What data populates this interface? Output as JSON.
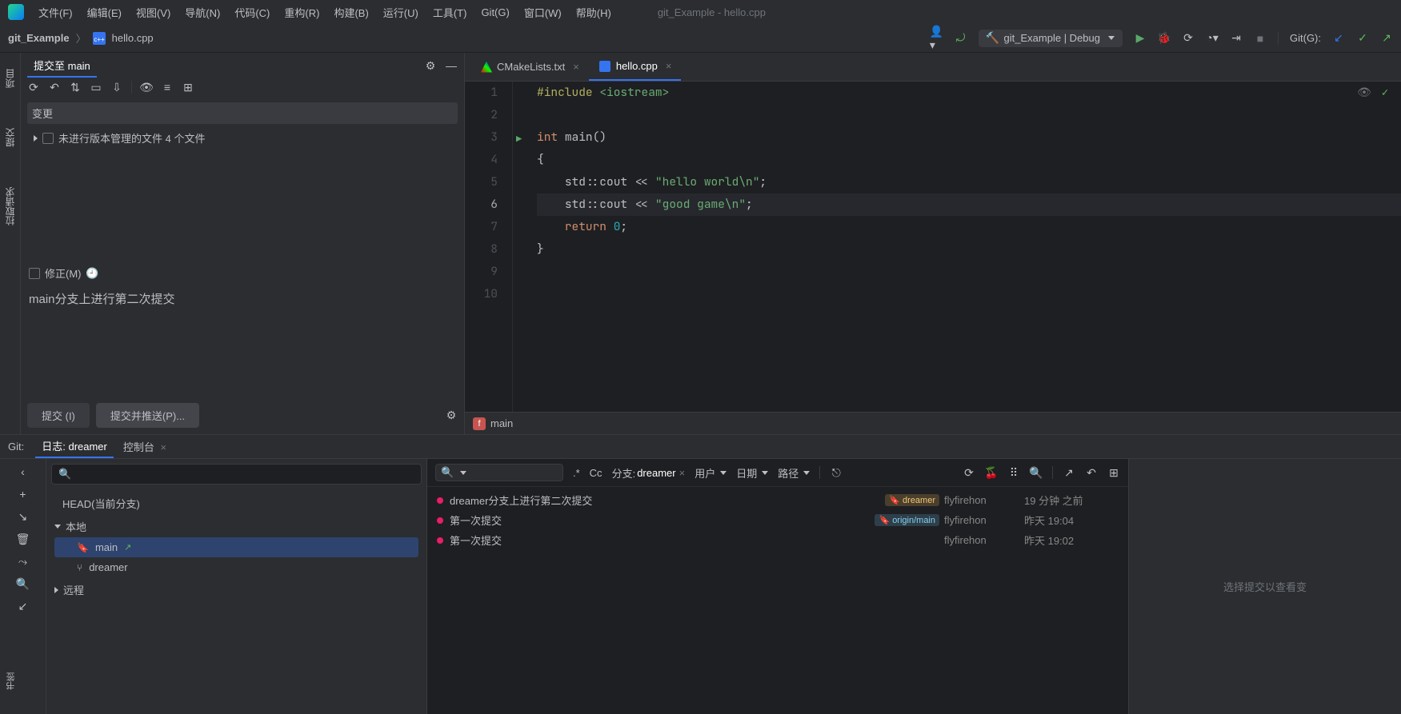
{
  "window_title": "git_Example - hello.cpp",
  "menus": [
    "文件(F)",
    "编辑(E)",
    "视图(V)",
    "导航(N)",
    "代码(C)",
    "重构(R)",
    "构建(B)",
    "运行(U)",
    "工具(T)",
    "Git(G)",
    "窗口(W)",
    "帮助(H)"
  ],
  "breadcrumbs": {
    "project": "git_Example",
    "file": "hello.cpp"
  },
  "run_config": "git_Example | Debug",
  "git_label": "Git(G):",
  "commit_panel": {
    "tab": "提交至 main",
    "changes_label": "变更",
    "unversioned": "未进行版本管理的文件 4 个文件",
    "amend_label": "修正(M)",
    "message": "main分支上进行第二次提交",
    "btn_commit": "提交 (I)",
    "btn_commit_push": "提交并推送(P)..."
  },
  "left_tabs": {
    "project": "项目",
    "commit": "提交",
    "pull": "拉取请求"
  },
  "editor": {
    "tabs": [
      {
        "name": "CMakeLists.txt",
        "active": false
      },
      {
        "name": "hello.cpp",
        "active": true
      }
    ],
    "code_lines": [
      {
        "n": "1",
        "html": "<span class='inc'>#include</span> <span class='str'>&lt;iostream&gt;</span>"
      },
      {
        "n": "2",
        "html": ""
      },
      {
        "n": "3",
        "html": "<span class='kw'>int</span> <span class='ns'>main()</span>"
      },
      {
        "n": "4",
        "html": "<span class='ns'>{</span>"
      },
      {
        "n": "5",
        "html": "    <span class='ns'>std::cout &lt;&lt; </span><span class='str'>\"hello world\\n\"</span><span class='ns'>;</span>"
      },
      {
        "n": "6",
        "html": "    <span class='ns'>std::cout &lt;&lt; </span><span class='str'>\"good game\\n\"</span><span class='ns'>;</span>",
        "cur": true
      },
      {
        "n": "7",
        "html": "    <span class='kw'>return</span> <span class='num'>0</span><span class='ns'>;</span>"
      },
      {
        "n": "8",
        "html": "<span class='ns'>}</span>"
      },
      {
        "n": "9",
        "html": ""
      },
      {
        "n": "10",
        "html": ""
      }
    ],
    "fn_badge": "main"
  },
  "git_tabs": {
    "label": "Git:",
    "log_tab": "日志: dreamer",
    "console_tab": "控制台"
  },
  "branches": {
    "head": "HEAD(当前分支)",
    "local_label": "本地",
    "local": [
      "main",
      "dreamer"
    ],
    "remote_label": "远程"
  },
  "filters": {
    "branch_lbl": "分支:",
    "branch_val": "dreamer",
    "user_lbl": "用户",
    "date_lbl": "日期",
    "path_lbl": "路径",
    "regex": ".*",
    "cc": "Cc"
  },
  "commits": [
    {
      "msg": "dreamer分支上进行第二次提交",
      "tags": [
        {
          "text": "dreamer",
          "cls": "dreamer"
        }
      ],
      "author": "flyfirehon",
      "date": "19 分钟 之前"
    },
    {
      "msg": "第一次提交",
      "tags": [
        {
          "text": "origin/main",
          "cls": "origin"
        }
      ],
      "author": "flyfirehon",
      "date": "昨天 19:04"
    },
    {
      "msg": "第一次提交",
      "tags": [],
      "author": "flyfirehon",
      "date": "昨天 19:02"
    }
  ],
  "detail_placeholder": "选择提交以查看变",
  "bookmarks_label": "书签"
}
